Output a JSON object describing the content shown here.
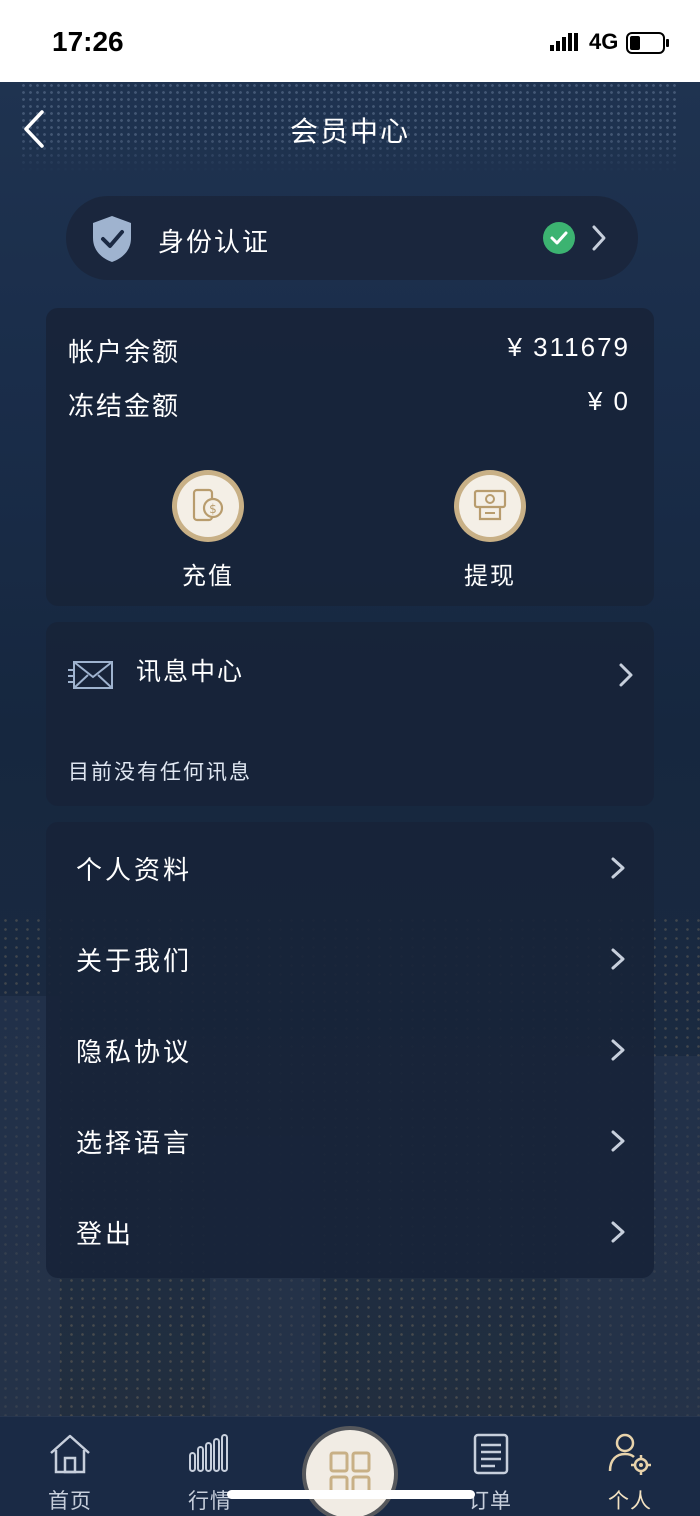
{
  "status_bar": {
    "time": "17:26",
    "network": "4G"
  },
  "header": {
    "title": "会员中心"
  },
  "identity": {
    "label": "身份认证"
  },
  "balance": {
    "account_label": "帐户余额",
    "account_value": "¥ 311679",
    "frozen_label": "冻结金额",
    "frozen_value": "¥ 0",
    "recharge_label": "充值",
    "withdraw_label": "提现"
  },
  "messages": {
    "title": "讯息中心",
    "empty_text": "目前没有任何讯息"
  },
  "menu": {
    "items": [
      {
        "label": "个人资料"
      },
      {
        "label": "关于我们"
      },
      {
        "label": "隐私协议"
      },
      {
        "label": "选择语言"
      },
      {
        "label": "登出"
      }
    ]
  },
  "tabbar": {
    "tabs": [
      {
        "label": "首页",
        "icon": "home-icon"
      },
      {
        "label": "行情",
        "icon": "market-icon"
      },
      {
        "label": "",
        "icon": "grid-icon"
      },
      {
        "label": "订单",
        "icon": "order-icon"
      },
      {
        "label": "个人",
        "icon": "user-settings-icon"
      }
    ]
  },
  "colors": {
    "accent_gold": "#c8b086",
    "verified_green": "#3cb371",
    "card_bg": "#18233a"
  }
}
